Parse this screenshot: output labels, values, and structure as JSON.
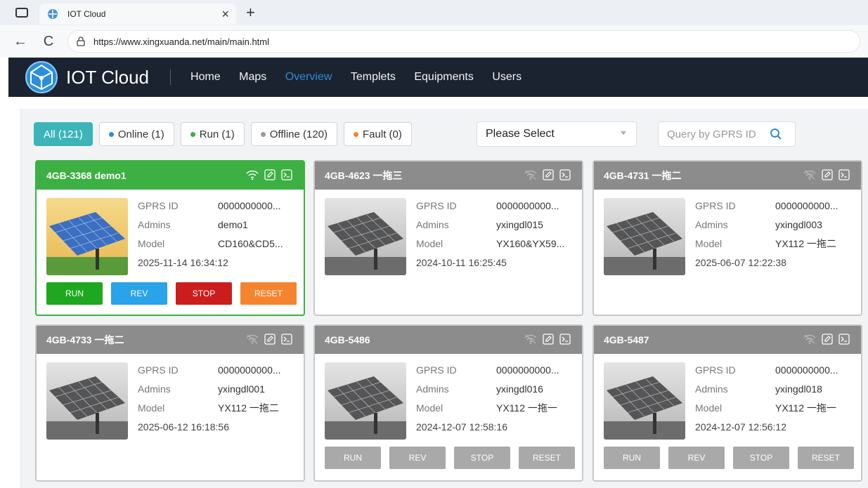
{
  "browser": {
    "tab_title": "IOT Cloud",
    "tab_close": "×",
    "new_tab": "+",
    "url": "https://www.xingxuanda.net/main/main.html",
    "back": "←",
    "reload": "C"
  },
  "header": {
    "brand": "IOT Cloud",
    "nav": [
      "Home",
      "Maps",
      "Overview",
      "Templets",
      "Equipments",
      "Users"
    ],
    "active_nav": "Overview"
  },
  "filters": {
    "all": "All (121)",
    "online": "Online (1)",
    "run": "Run (1)",
    "offline": "Offline (120)",
    "fault": "Fault (0)",
    "colors": {
      "online": "#2a8fdb",
      "run": "#3cb043",
      "offline": "#9a9a9a",
      "fault": "#f5842e",
      "all_bg": "#3cb4b8"
    }
  },
  "select": {
    "value": "Please Select"
  },
  "search": {
    "placeholder": "Query by GPRS ID"
  },
  "labels": {
    "gprs": "GPRS ID",
    "admins": "Admins",
    "model": "Model"
  },
  "buttons": {
    "run": "RUN",
    "rev": "REV",
    "stop": "STOP",
    "reset": "RESET"
  },
  "devices": [
    {
      "title": "4GB-3368 demo1",
      "gprs": "0000000000...",
      "admins": "demo1",
      "model": "CD160&CD5...",
      "date": "2025-11-14 16:34:12",
      "online": true,
      "wifi_icon": "wifi-icon"
    },
    {
      "title": "4GB-4623 一拖三",
      "gprs": "0000000000...",
      "admins": "yxingdl015",
      "model": "YX160&YX59...",
      "date": "2024-10-11 16:25:45",
      "online": false,
      "wifi_icon": "wifi-off-icon"
    },
    {
      "title": "4GB-4731 一拖二",
      "gprs": "0000000000...",
      "admins": "yxingdl003",
      "model": "YX112 一拖二",
      "date": "2025-06-07 12:22:38",
      "online": false,
      "wifi_icon": "wifi-off-icon"
    },
    {
      "title": "4GB-4733 一拖二",
      "gprs": "0000000000...",
      "admins": "yxingdl001",
      "model": "YX112 一拖二",
      "date": "2025-06-12 16:18:56",
      "online": false,
      "wifi_icon": "wifi-off-icon"
    },
    {
      "title": "4GB-5486",
      "gprs": "0000000000...",
      "admins": "yxingdl016",
      "model": "YX112 一拖一",
      "date": "2024-12-07 12:58:16",
      "online": false,
      "wifi_icon": "wifi-off-icon"
    },
    {
      "title": "4GB-5487",
      "gprs": "0000000000...",
      "admins": "yxingdl018",
      "model": "YX112 一拖一",
      "date": "2024-12-07 12:56:12",
      "online": false,
      "wifi_icon": "wifi-off-icon"
    }
  ]
}
